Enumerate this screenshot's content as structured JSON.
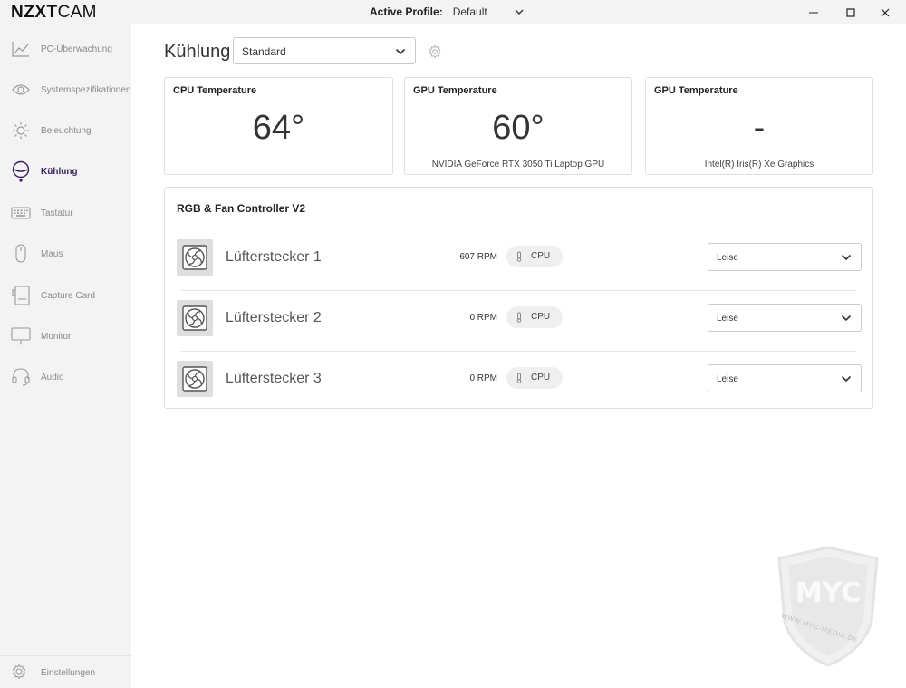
{
  "app": {
    "logo_bold": "NZXT",
    "logo_light": "CAM",
    "active_profile_label": "Active Profile:",
    "active_profile_value": "Default"
  },
  "sidebar": {
    "items": [
      {
        "label": "PC-Überwachung",
        "icon": "line-chart-icon"
      },
      {
        "label": "Systemspezifikationen",
        "icon": "eye-icon"
      },
      {
        "label": "Beleuchtung",
        "icon": "sun-icon"
      },
      {
        "label": "Kühlung",
        "icon": "cooling-icon",
        "active": true
      },
      {
        "label": "Tastatur",
        "icon": "keyboard-icon"
      },
      {
        "label": "Maus",
        "icon": "mouse-icon"
      },
      {
        "label": "Capture Card",
        "icon": "capture-card-icon"
      },
      {
        "label": "Monitor",
        "icon": "monitor-icon"
      },
      {
        "label": "Audio",
        "icon": "headset-icon"
      }
    ],
    "settings_label": "Einstellungen"
  },
  "main": {
    "title": "Kühlung",
    "profile_select": "Standard",
    "cards": [
      {
        "title": "CPU Temperature",
        "value": "64°",
        "subtitle": ""
      },
      {
        "title": "GPU Temperature",
        "value": "60°",
        "subtitle": "NVIDIA GeForce RTX 3050 Ti Laptop GPU"
      },
      {
        "title": "GPU Temperature",
        "value": "-",
        "subtitle": "Intel(R) Iris(R) Xe Graphics"
      }
    ],
    "controller": {
      "title": "RGB & Fan Controller V2",
      "fans": [
        {
          "name": "Lüfterstecker 1",
          "rpm": "607 RPM",
          "source": "CPU",
          "mode": "Leise"
        },
        {
          "name": "Lüfterstecker 2",
          "rpm": "0 RPM",
          "source": "CPU",
          "mode": "Leise"
        },
        {
          "name": "Lüfterstecker 3",
          "rpm": "0 RPM",
          "source": "CPU",
          "mode": "Leise"
        }
      ]
    }
  },
  "watermark": {
    "letters": "MYC",
    "text": "WWW.MYC-MEDIA.DE"
  },
  "colors": {
    "active": "#3b1f5c",
    "inactive_text": "#8a8a8a",
    "sidebar_bg": "#f3f3f3"
  }
}
